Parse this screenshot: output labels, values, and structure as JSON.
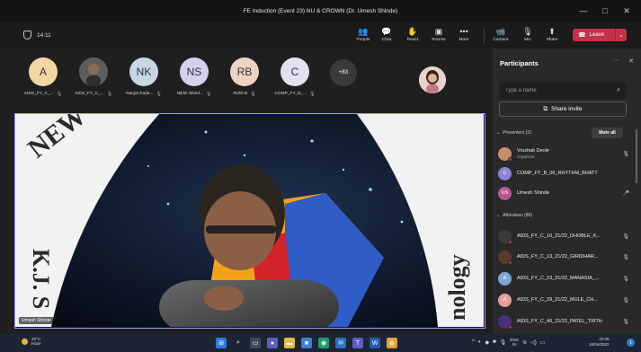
{
  "window": {
    "title": "FE Induction (Event 23) NU & CROWN (Dr. Umesh Shinde)",
    "controls": [
      "—",
      "□",
      "✕"
    ]
  },
  "meeting": {
    "timer": "14:11",
    "toolbar": [
      {
        "label": "People",
        "icon": "people-icon",
        "glyph": "👥",
        "active": true
      },
      {
        "label": "Chat",
        "icon": "chat-icon",
        "glyph": "💬",
        "active": false
      },
      {
        "label": "React",
        "icon": "react-icon",
        "glyph": "✋",
        "active": false
      },
      {
        "label": "Rooms",
        "icon": "rooms-icon",
        "glyph": "▣",
        "active": false
      },
      {
        "label": "More",
        "icon": "more-icon",
        "glyph": "•••",
        "active": false
      }
    ],
    "devices": [
      {
        "label": "Camera",
        "icon": "camera-off-icon",
        "glyph": "📹"
      },
      {
        "label": "Mic",
        "icon": "mic-off-icon",
        "glyph": "🎙"
      },
      {
        "label": "Share",
        "icon": "share-tray-icon",
        "glyph": "⬆"
      }
    ],
    "leave_label": "Leave"
  },
  "strip": {
    "participants": [
      {
        "initials": "A",
        "name": "AIDS_FY_C_...",
        "color": "#f3d6a6"
      },
      {
        "initials": "",
        "name": "AIDS_FY_C_...",
        "color": "#3b3b3b",
        "photo": true
      },
      {
        "initials": "NK",
        "name": "Nargis Kade...",
        "color": "#c6d8e4"
      },
      {
        "initials": "NS",
        "name": "Nikhil Shind...",
        "color": "#d3d0f0"
      },
      {
        "initials": "RB",
        "name": "Rohit B",
        "color": "#eed3c5"
      },
      {
        "initials": "C",
        "name": "COMP_FY_B_...",
        "color": "#e4e1f5"
      }
    ],
    "more_count": "+83"
  },
  "stage": {
    "speaker_label": "Umesh Shinde",
    "banner_texts": [
      "NEW",
      "K.J. S",
      "nology"
    ]
  },
  "panel": {
    "title": "Participants",
    "search_placeholder": "Type a name",
    "share_invite": "Share invite",
    "presenters_header": "Presenters (3)",
    "mute_all": "Mute all",
    "attendees_header": "Attendees (88)",
    "presenters": [
      {
        "name": "Vrushak Deole",
        "role": "Organizer",
        "avatar_color": "#c98c6a",
        "initials": ""
      },
      {
        "name": "COMP_FY_B_09_RHYTHM_BHATT",
        "role": "",
        "avatar_color": "#8a83d8",
        "initials": "C"
      },
      {
        "name": "Umesh Shinde",
        "role": "",
        "avatar_color": "#b4598f",
        "initials": "US"
      }
    ],
    "attendees": [
      {
        "name": "AIDS_FY_C_10_21/22_DHOBLE_K...",
        "avatar_color": "#3a3a3a",
        "initials": ""
      },
      {
        "name": "AIDS_FY_C_13_21/22_GIRIDHAR...",
        "avatar_color": "#5b3a2e",
        "initials": ""
      },
      {
        "name": "AIDS_FY_C_23_21/22_MANASIA_...",
        "avatar_color": "#7fa6d6",
        "initials": "A"
      },
      {
        "name": "AIDS_FY_C_29_21/22_MULE_CH...",
        "avatar_color": "#e79d9d",
        "initials": "A"
      },
      {
        "name": "AIDS_FY_C_40_21/22_PATEL_TIRTH",
        "avatar_color": "#4a2f80",
        "initials": ""
      }
    ]
  },
  "taskbar": {
    "weather_temp": "30°C",
    "weather_desc": "Haze",
    "lang_top": "ENG",
    "lang_bottom": "IN",
    "time": "10:05",
    "date": "16/04/2022",
    "notifications": "1"
  },
  "colors": {
    "accent": "#9d9bff",
    "leave": "#c4314b",
    "panel_bg": "#292929"
  }
}
